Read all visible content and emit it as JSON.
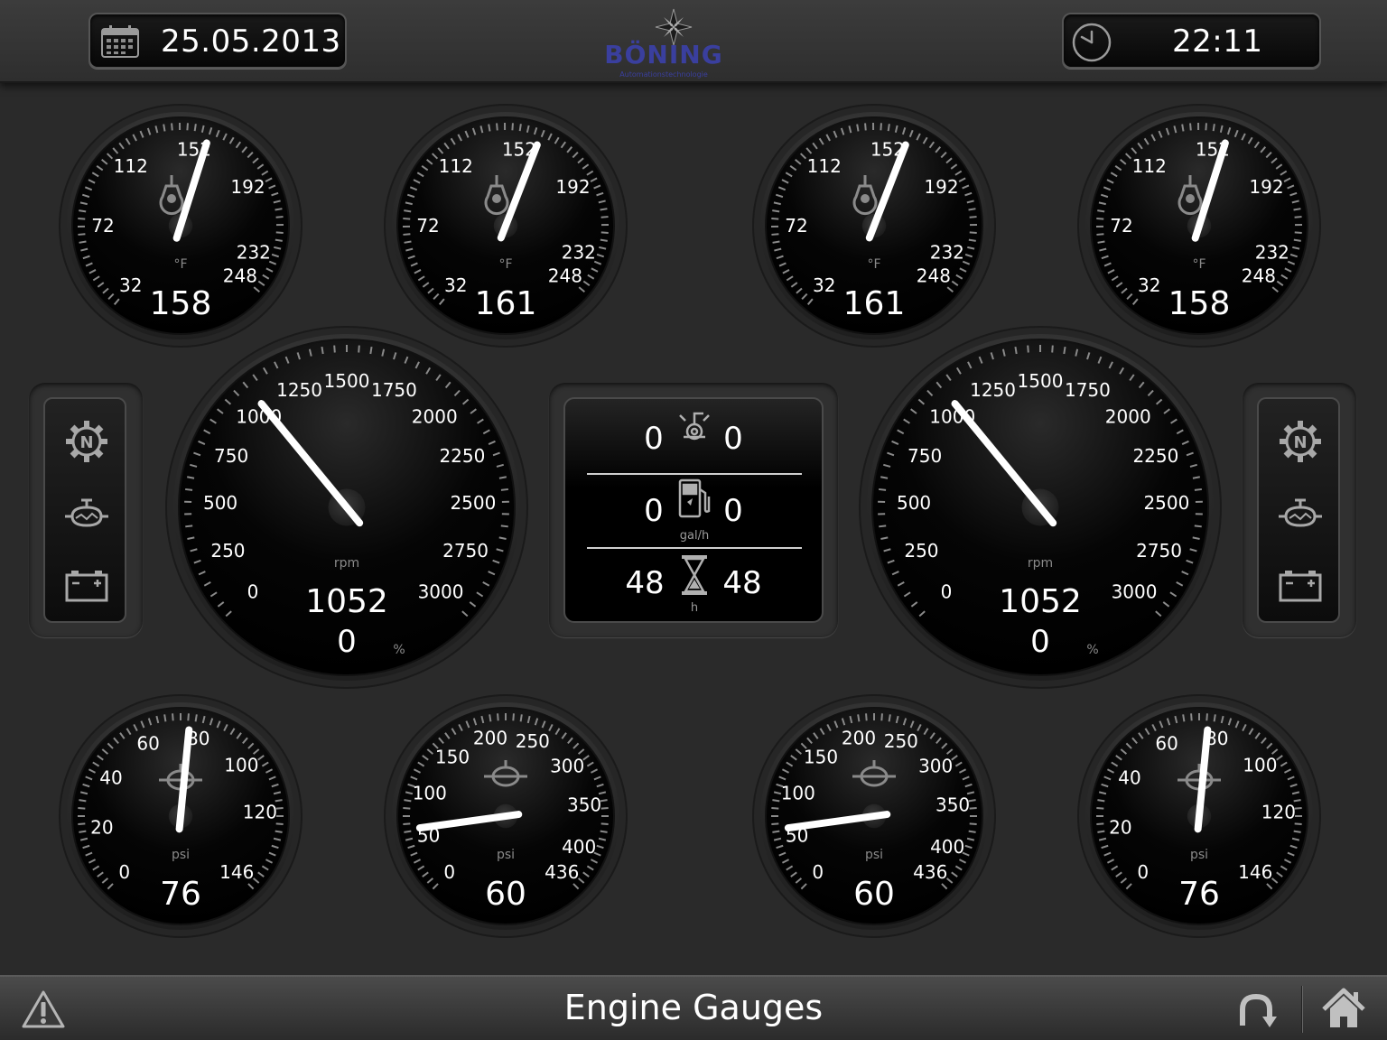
{
  "header": {
    "date": "25.05.2013",
    "time": "22:11",
    "logo": {
      "name": "BÖNING",
      "tagline": "Automationstechnologie"
    }
  },
  "gauges": {
    "temperature": [
      {
        "value": "158",
        "unit": "°F",
        "needle": 158,
        "ticks": [
          "32",
          "72",
          "112",
          "152",
          "192",
          "232",
          "248"
        ]
      },
      {
        "value": "161",
        "unit": "°F",
        "needle": 161,
        "ticks": [
          "32",
          "72",
          "112",
          "152",
          "192",
          "232",
          "248"
        ]
      },
      {
        "value": "161",
        "unit": "°F",
        "needle": 161,
        "ticks": [
          "32",
          "72",
          "112",
          "152",
          "192",
          "232",
          "248"
        ]
      },
      {
        "value": "158",
        "unit": "°F",
        "needle": 158,
        "ticks": [
          "32",
          "72",
          "112",
          "152",
          "192",
          "232",
          "248"
        ]
      }
    ],
    "rpm": [
      {
        "value": "1052",
        "load": "0",
        "unit": "rpm",
        "load_unit": "%",
        "needle": 1052,
        "ticks": [
          "0",
          "250",
          "500",
          "750",
          "1000",
          "1250",
          "1500",
          "1750",
          "2000",
          "2250",
          "2500",
          "2750",
          "3000"
        ]
      },
      {
        "value": "1052",
        "load": "0",
        "unit": "rpm",
        "load_unit": "%",
        "needle": 1052,
        "ticks": [
          "0",
          "250",
          "500",
          "750",
          "1000",
          "1250",
          "1500",
          "1750",
          "2000",
          "2250",
          "2500",
          "2750",
          "3000"
        ]
      }
    ],
    "oil_pressure": [
      {
        "value": "76",
        "unit": "psi",
        "needle": 76,
        "ticks": [
          "0",
          "20",
          "40",
          "60",
          "80",
          "100",
          "120",
          "146"
        ]
      },
      {
        "value": "76",
        "unit": "psi",
        "needle": 76,
        "ticks": [
          "0",
          "20",
          "40",
          "60",
          "80",
          "100",
          "120",
          "146"
        ]
      }
    ],
    "fuel_pressure": [
      {
        "value": "60",
        "unit": "psi",
        "needle": 60,
        "ticks": [
          "0",
          "50",
          "100",
          "150",
          "200",
          "250",
          "300",
          "350",
          "400",
          "436"
        ]
      },
      {
        "value": "60",
        "unit": "psi",
        "needle": 60,
        "ticks": [
          "0",
          "50",
          "100",
          "150",
          "200",
          "250",
          "300",
          "350",
          "400",
          "436"
        ]
      }
    ]
  },
  "center_panel": {
    "trim": {
      "left": "0",
      "right": "0",
      "icon": "trim-icon"
    },
    "fuel_rate": {
      "left": "0",
      "right": "0",
      "unit": "gal/h",
      "icon": "fuel-pump-icon"
    },
    "hours": {
      "left": "48",
      "right": "48",
      "unit": "h",
      "icon": "hourglass-icon"
    }
  },
  "side_panels": {
    "icons": [
      "neutral-gear-icon",
      "engine-icon",
      "battery-icon"
    ]
  },
  "footer": {
    "title": "Engine Gauges",
    "icons": [
      "warning-icon",
      "reconnect-icon",
      "home-icon"
    ]
  },
  "colors": {
    "background": "#2a2a2a",
    "logo": "#3a3f9e",
    "needle": "#ffffff"
  }
}
